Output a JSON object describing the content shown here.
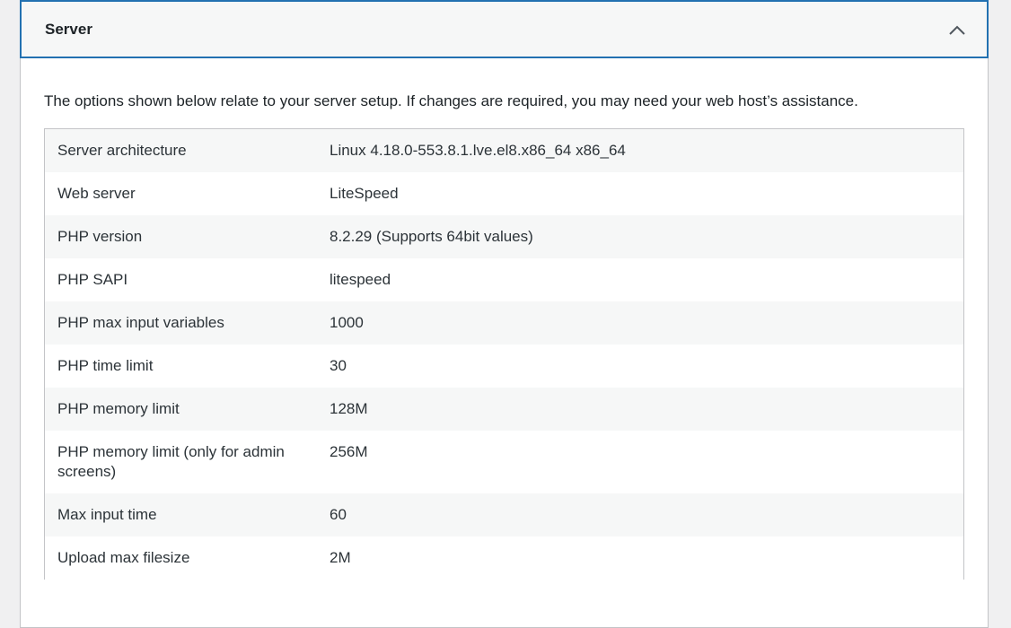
{
  "section": {
    "title": "Server",
    "toggle_icon": "chevron-up-icon",
    "intro": "The options shown below relate to your server setup. If changes are required, you may need your web host’s assistance."
  },
  "rows": [
    {
      "label": "Server architecture",
      "value": "Linux 4.18.0-553.8.1.lve.el8.x86_64 x86_64"
    },
    {
      "label": "Web server",
      "value": "LiteSpeed"
    },
    {
      "label": "PHP version",
      "value": "8.2.29 (Supports 64bit values)"
    },
    {
      "label": "PHP SAPI",
      "value": "litespeed"
    },
    {
      "label": "PHP max input variables",
      "value": "1000"
    },
    {
      "label": "PHP time limit",
      "value": "30"
    },
    {
      "label": "PHP memory limit",
      "value": "128M"
    },
    {
      "label": "PHP memory limit (only for admin screens)",
      "value": "256M"
    },
    {
      "label": "Max input time",
      "value": "60"
    },
    {
      "label": "Upload max filesize",
      "value": "2M"
    }
  ],
  "colors": {
    "focus_border": "#2271b1",
    "header_bg": "#f6f7f7",
    "page_bg": "#f0f0f1"
  }
}
